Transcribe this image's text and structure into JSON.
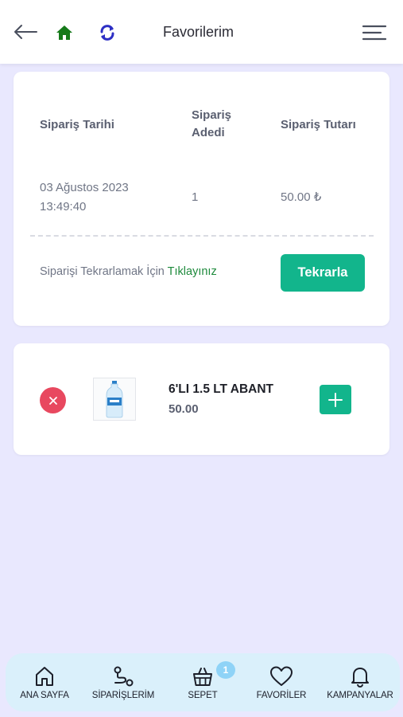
{
  "header": {
    "title": "Favorilerim",
    "back_icon": "arrow-left-icon",
    "home_icon": "home-icon",
    "refresh_icon": "refresh-icon",
    "menu_icon": "menu-icon"
  },
  "order": {
    "columns": [
      "Sipariş Tarihi",
      "Sipariş Adedi",
      "Sipariş Tutarı"
    ],
    "date_line1": "03 Ağustos 2023",
    "date_line2": "13:49:40",
    "quantity": "1",
    "amount": "50.00 ₺",
    "repeat_prompt": "Siparişi Tekrarlamak İçin",
    "repeat_link": "Tıklayınız",
    "repeat_button": "Tekrarla"
  },
  "favorite_item": {
    "name": "6'LI 1.5 LT ABANT",
    "price": "50.00"
  },
  "bottom_nav": {
    "items": [
      {
        "label": "ANA SAYFA",
        "icon": "home-outline-icon"
      },
      {
        "label": "SİPARİŞLERİM",
        "icon": "route-icon"
      },
      {
        "label": "SEPET",
        "icon": "basket-icon"
      },
      {
        "label": "FAVORİLER",
        "icon": "heart-icon"
      },
      {
        "label": "KAMPANYALAR",
        "icon": "bell-icon"
      }
    ],
    "cart_badge": "1"
  },
  "colors": {
    "background": "#e9e8fe",
    "accent_green": "#12b58c",
    "remove_red": "#e8485f",
    "home_icon_green": "#167a1a",
    "refresh_icon_blue": "#2d2fc4",
    "link_green": "#1e8a3c",
    "nav_background": "#daf0fb",
    "badge_blue": "#8fd3f7"
  }
}
